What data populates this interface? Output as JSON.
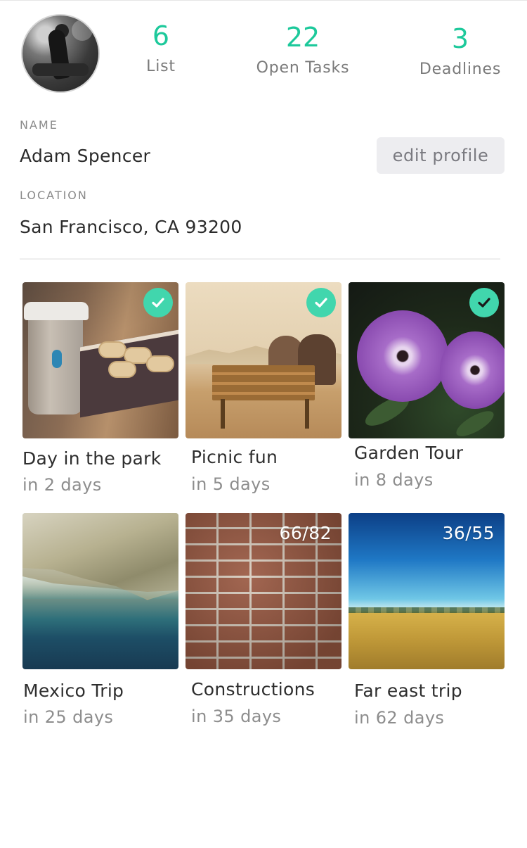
{
  "profile": {
    "avatar_alt": "avatar",
    "stats": [
      {
        "value": "6",
        "label": "List"
      },
      {
        "value": "22",
        "label": "Open Tasks"
      },
      {
        "value": "3",
        "label": "Deadlines"
      }
    ],
    "name_label": "NAME",
    "name": "Adam Spencer",
    "edit_label": "edit profile",
    "location_label": "LOCATION",
    "location": "San Francisco, CA 93200"
  },
  "lists": [
    {
      "title": "Day in the park",
      "due": "in 2 days",
      "status": "done"
    },
    {
      "title": "Picnic fun",
      "due": "in 5 days",
      "status": "done"
    },
    {
      "title": "Garden Tour",
      "due": "in 8 days",
      "status": "done"
    },
    {
      "title": "Mexico Trip",
      "due": "in 25 days",
      "status": "none"
    },
    {
      "title": "Constructions",
      "due": "in 35 days",
      "status": "progress",
      "progress": "66/82"
    },
    {
      "title": "Far east trip",
      "due": "in 62 days",
      "status": "progress",
      "progress": "36/55"
    }
  ],
  "colors": {
    "accent": "#1dc99b",
    "check": "#41d6ad",
    "button_bg": "#ededf0"
  },
  "icons": {
    "check": "check-icon"
  }
}
